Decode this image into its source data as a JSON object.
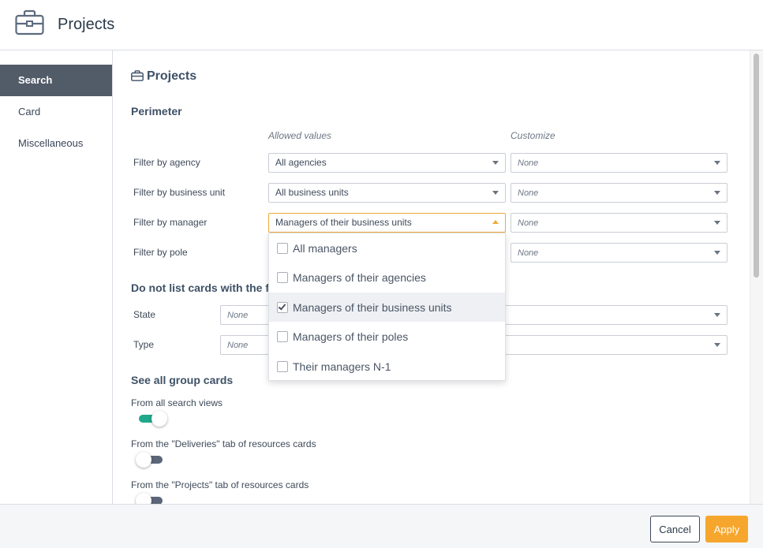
{
  "header": {
    "title": "Projects",
    "icon": "briefcase-icon"
  },
  "sidebar": {
    "items": [
      {
        "label": "Search",
        "active": true
      },
      {
        "label": "Card",
        "active": false
      },
      {
        "label": "Miscellaneous",
        "active": false
      }
    ]
  },
  "main": {
    "title": "Projects",
    "perimeter": {
      "title": "Perimeter",
      "col_allowed": "Allowed values",
      "col_customize": "Customize",
      "rows": [
        {
          "label": "Filter by agency",
          "allowed": "All agencies",
          "customize": "None"
        },
        {
          "label": "Filter by business unit",
          "allowed": "All business units",
          "customize": "None"
        },
        {
          "label": "Filter by manager",
          "allowed": "Managers of their business units",
          "customize": "None"
        },
        {
          "label": "Filter by pole",
          "allowed": "",
          "customize": "None"
        }
      ]
    },
    "dropdown": {
      "options": [
        {
          "label": "All managers",
          "checked": false
        },
        {
          "label": "Managers of their agencies",
          "checked": false
        },
        {
          "label": "Managers of their business units",
          "checked": true
        },
        {
          "label": "Managers of their poles",
          "checked": false
        },
        {
          "label": "Their managers N-1",
          "checked": false
        }
      ]
    },
    "do_not_list": {
      "title": "Do not list cards with the fol",
      "rows": [
        {
          "label": "State",
          "value": "None"
        },
        {
          "label": "Type",
          "value": "None"
        }
      ]
    },
    "group_cards": {
      "title": "See all group cards",
      "toggles": [
        {
          "label": "From all search views",
          "on": true
        },
        {
          "label": "From the \"Deliveries\" tab of resources cards",
          "on": false
        },
        {
          "label": "From the \"Projects\" tab of resources cards",
          "on": false
        }
      ]
    }
  },
  "footer": {
    "cancel_label": "Cancel",
    "apply_label": "Apply"
  },
  "colors": {
    "accent": "#f6a62d",
    "toggle_on": "#1fa88b",
    "sidebar_active": "#525b68"
  }
}
